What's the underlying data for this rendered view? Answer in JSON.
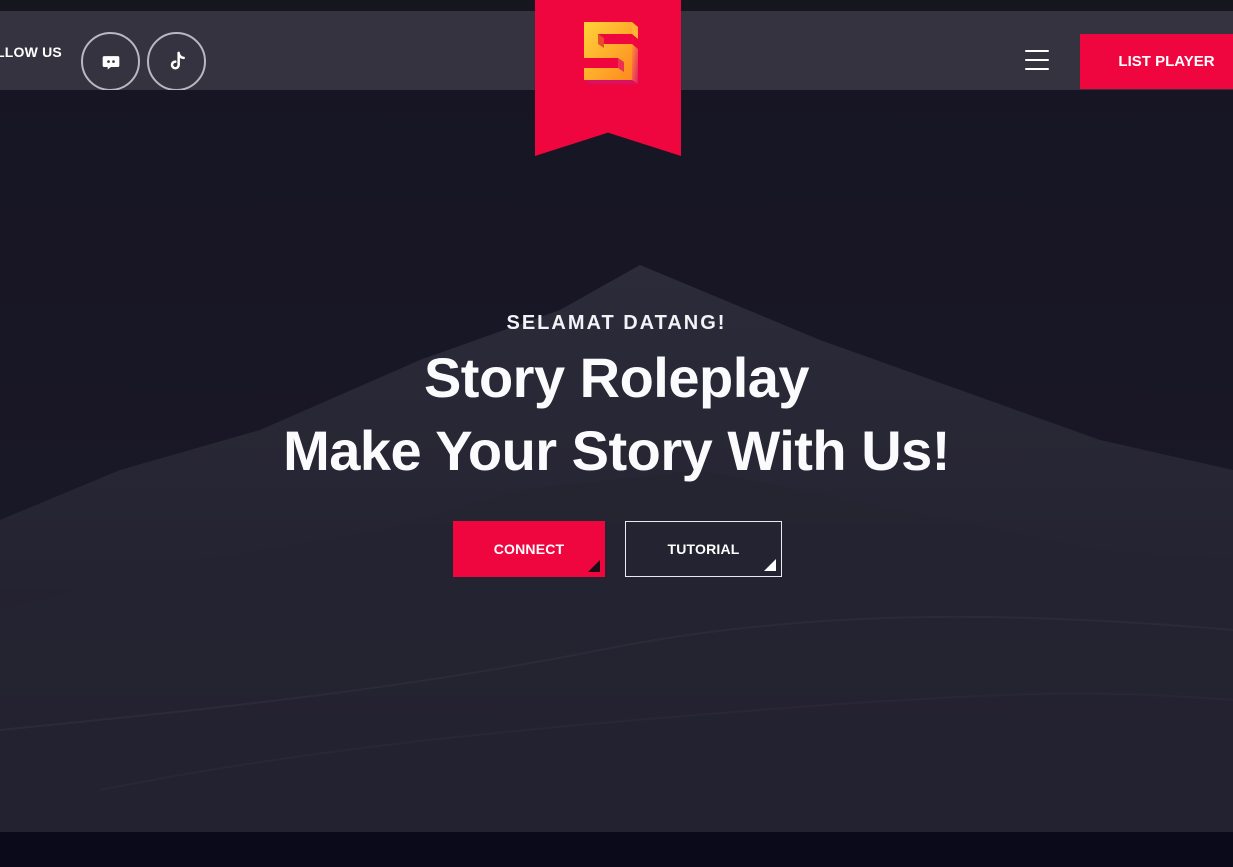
{
  "nav": {
    "follow_label": "LLOW US",
    "social": [
      {
        "name": "discord-icon"
      },
      {
        "name": "tiktok-icon"
      }
    ],
    "list_player_label": "LIST PLAYER"
  },
  "brand": {
    "logo_icon": "story-s-logo",
    "accent": "#f0063f"
  },
  "hero": {
    "kicker": "SELAMAT DATANG!",
    "line1": "Story Roleplay",
    "line2": "Make Your Story With Us!",
    "connect_label": "CONNECT",
    "tutorial_label": "TUTORIAL"
  }
}
